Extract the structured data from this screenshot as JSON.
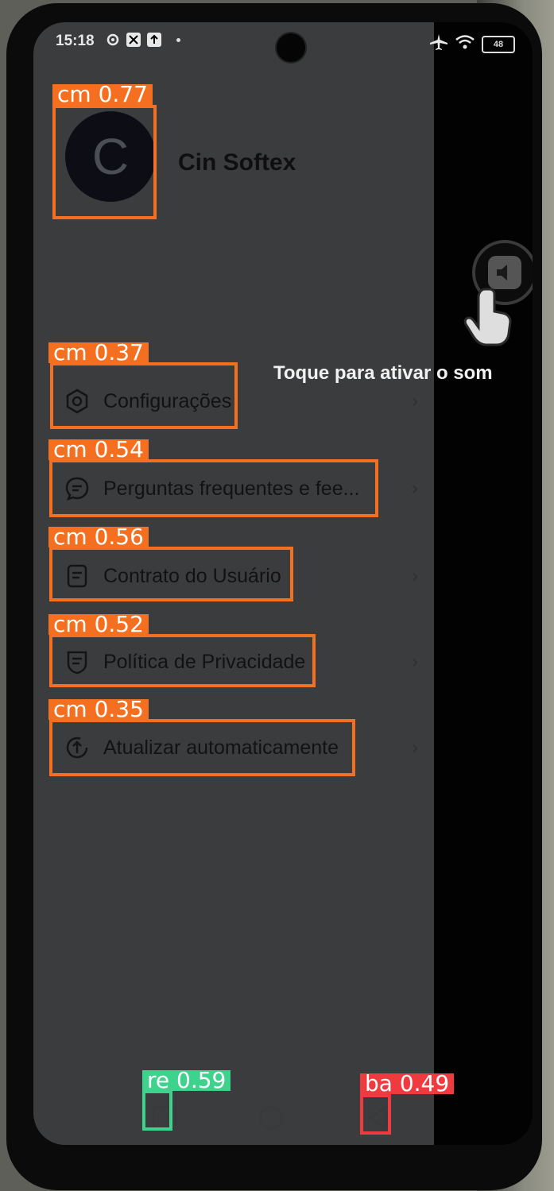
{
  "status_bar": {
    "time": "15:18",
    "battery": "48",
    "left_icons": [
      "settings-gear-icon",
      "no-signal-icon",
      "upload-icon"
    ],
    "right_icons": [
      "airplane-icon",
      "wifi-icon",
      "battery-icon"
    ]
  },
  "profile": {
    "avatar_letter": "C",
    "name": "Cin Softex"
  },
  "menu": [
    {
      "label": "Configurações",
      "icon": "settings-hex-icon"
    },
    {
      "label": "Perguntas frequentes e fee...",
      "icon": "chat-bubble-icon"
    },
    {
      "label": "Contrato do Usuário",
      "icon": "document-icon"
    },
    {
      "label": "Política de Privacidade",
      "icon": "shield-doc-icon"
    },
    {
      "label": "Atualizar automaticamente",
      "icon": "update-icon"
    }
  ],
  "sound_hint": {
    "tooltip": "Toque para ativar o som"
  },
  "detections": [
    {
      "label": "cm 0.77"
    },
    {
      "label": "cm 0.37"
    },
    {
      "label": "cm 0.54"
    },
    {
      "label": "cm 0.56"
    },
    {
      "label": "cm 0.52"
    },
    {
      "label": "cm 0.35"
    },
    {
      "label": "re 0.59"
    },
    {
      "label": "ba 0.49"
    }
  ],
  "colors": {
    "detection_orange": "#f47020",
    "detection_green": "#3ed38c",
    "detection_red": "#ef3b3f",
    "drawer_bg": "#3b3c3e"
  }
}
